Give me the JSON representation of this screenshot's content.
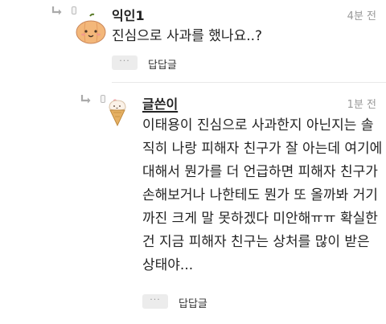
{
  "comments": [
    {
      "nickname": "익인1",
      "time": "4분 전",
      "avatar_icon": "pumpkin-icon",
      "lines": [
        "진심으로 사과를 했나요..?"
      ],
      "more_label": "···",
      "reply_label": "답답글"
    },
    {
      "nickname": "글쓴이",
      "time": "1분 전",
      "avatar_icon": "ice-cream-cone-icon",
      "lines": [
        "이태용이 진심으로 사과한지 아닌지는 솔",
        "직히 나랑 피해자 친구가 잘 아는데 여기에",
        "대해서 뭔가를 더 언급하면 피해자 친구가",
        "손해보거나 나한테도 뭔가 또 올까봐 거기",
        "까진 크게 말 못하겠다 미안해ㅠㅠ 확실한",
        "건 지금 피해자 친구는 상처를 많이 받은",
        "상태야..."
      ],
      "more_label": "···",
      "reply_label": "답답글"
    }
  ]
}
